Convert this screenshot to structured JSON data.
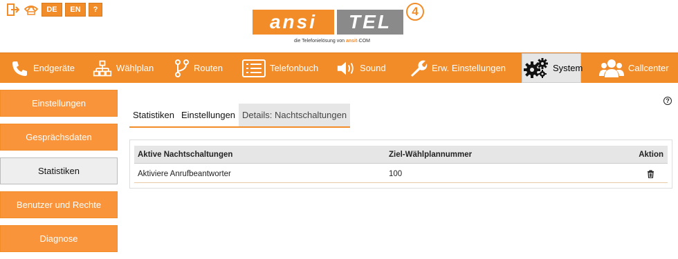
{
  "top_icons": {
    "logout_label": "",
    "phone_label": "",
    "lang_de": "DE",
    "lang_en": "EN",
    "help_label": "?"
  },
  "logo": {
    "left_text": "ansi",
    "right_text": "TEL",
    "version": "4",
    "tagline_prefix": "die Telefonielösung von",
    "tagline_brand": "ansit",
    "tagline_suffix": "·COM"
  },
  "nav": {
    "items": [
      {
        "label": "Endgeräte",
        "icon": "phone-icon"
      },
      {
        "label": "Wählplan",
        "icon": "sitemap-icon"
      },
      {
        "label": "Routen",
        "icon": "route-icon"
      },
      {
        "label": "Telefonbuch",
        "icon": "addressbook-icon"
      },
      {
        "label": "Sound",
        "icon": "speaker-icon"
      },
      {
        "label": "Erw. Einstellungen",
        "icon": "wrench-icon"
      },
      {
        "label": "System",
        "icon": "gears-icon",
        "active": true
      },
      {
        "label": "Callcenter",
        "icon": "users-icon"
      }
    ]
  },
  "sidebar": {
    "items": [
      {
        "label": "Einstellungen"
      },
      {
        "label": "Gesprächsdaten"
      },
      {
        "label": "Statistiken",
        "active": true
      },
      {
        "label": "Benutzer und Rechte"
      },
      {
        "label": "Diagnose"
      }
    ]
  },
  "help_icon": "?",
  "tabs": [
    {
      "label": "Statistiken"
    },
    {
      "label": "Einstellungen"
    },
    {
      "label": "Details: Nachtschaltungen",
      "active": true
    }
  ],
  "table": {
    "headers": [
      "Aktive Nachtschaltungen",
      "Ziel-Wählplannummer",
      "Aktion"
    ],
    "rows": [
      {
        "name": "Aktiviere Anrufbeantworter",
        "target": "100",
        "action_icon": "trash-icon"
      }
    ]
  },
  "colors": {
    "accent": "#f28c28",
    "nav_active_bg": "#e6e6e6",
    "sidebar_btn": "#f9943a"
  }
}
